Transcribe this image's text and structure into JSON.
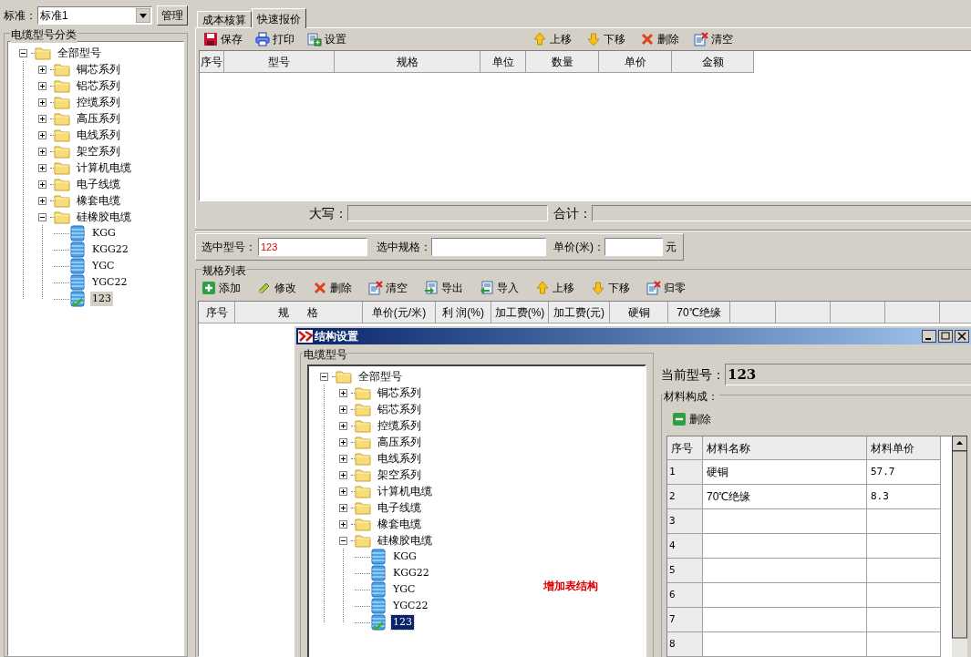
{
  "standard": {
    "label": "标准：",
    "value": "标准1",
    "manage_button": "管理"
  },
  "category_panel": {
    "title": "电缆型号分类",
    "tree": [
      {
        "label": "全部型号",
        "kind": "folder",
        "expanded": true,
        "selected": false,
        "children": [
          {
            "label": "铜芯系列",
            "kind": "folder",
            "expanded": false,
            "selected": false
          },
          {
            "label": "铝芯系列",
            "kind": "folder",
            "expanded": false,
            "selected": false
          },
          {
            "label": "控缆系列",
            "kind": "folder",
            "expanded": false,
            "selected": false
          },
          {
            "label": "高压系列",
            "kind": "folder",
            "expanded": false,
            "selected": false
          },
          {
            "label": "电线系列",
            "kind": "folder",
            "expanded": false,
            "selected": false
          },
          {
            "label": "架空系列",
            "kind": "folder",
            "expanded": false,
            "selected": false
          },
          {
            "label": "计算机电缆",
            "kind": "folder",
            "expanded": false,
            "selected": false
          },
          {
            "label": "电子线缆",
            "kind": "folder",
            "expanded": false,
            "selected": false
          },
          {
            "label": "橡套电缆",
            "kind": "folder",
            "expanded": false,
            "selected": false
          },
          {
            "label": "硅橡胶电缆",
            "kind": "folder",
            "expanded": true,
            "selected": false,
            "children": [
              {
                "label": "KGG",
                "kind": "model",
                "checked": false,
                "selected": false
              },
              {
                "label": "KGG22",
                "kind": "model",
                "checked": false,
                "selected": false
              },
              {
                "label": "YGC",
                "kind": "model",
                "checked": false,
                "selected": false
              },
              {
                "label": "YGC22",
                "kind": "model",
                "checked": false,
                "selected": false
              },
              {
                "label": "123",
                "kind": "model",
                "checked": true,
                "selected": true
              }
            ]
          }
        ]
      }
    ]
  },
  "tabs": [
    {
      "label": "成本核算",
      "selected": false
    },
    {
      "label": "快速报价",
      "selected": true
    }
  ],
  "quote": {
    "toolbar_left": [
      {
        "kind": "save",
        "label": "保存"
      },
      {
        "kind": "print",
        "label": "打印"
      },
      {
        "kind": "settings",
        "label": "设置"
      }
    ],
    "toolbar_right": [
      {
        "kind": "up",
        "label": "上移"
      },
      {
        "kind": "down",
        "label": "下移"
      },
      {
        "kind": "delete",
        "label": "删除"
      },
      {
        "kind": "clear",
        "label": "清空"
      }
    ],
    "columns": [
      "序号",
      "型号",
      "规格",
      "单位",
      "数量",
      "单价",
      "金额"
    ],
    "uppercase_label": "大写：",
    "total_label": "合计："
  },
  "selection": {
    "model_label": "选中型号：",
    "model_value": "123",
    "spec_label": "选中规格：",
    "price_label": "单价(米)：",
    "price_unit": "元"
  },
  "spec_list": {
    "title": "规格列表",
    "toolbar": [
      {
        "kind": "add",
        "label": "添加"
      },
      {
        "kind": "edit",
        "label": "修改"
      },
      {
        "kind": "delete",
        "label": "删除"
      },
      {
        "kind": "clear",
        "label": "清空"
      },
      {
        "kind": "export",
        "label": "导出"
      },
      {
        "kind": "import",
        "label": "导入"
      },
      {
        "kind": "up",
        "label": "上移"
      },
      {
        "kind": "down",
        "label": "下移"
      },
      {
        "kind": "clear",
        "label": "归零"
      }
    ],
    "columns": [
      "序号",
      "规      格",
      "单价(元/米)",
      "利 润(%)",
      "加工费(%)",
      "加工费(元)",
      "硬铜",
      "70℃绝缘"
    ]
  },
  "dialog": {
    "title": "结构设置",
    "tree_group": "电缆型号",
    "tree": [
      {
        "label": "全部型号",
        "kind": "folder",
        "expanded": true,
        "selected": false,
        "children": [
          {
            "label": "铜芯系列",
            "kind": "folder",
            "expanded": false,
            "selected": false
          },
          {
            "label": "铝芯系列",
            "kind": "folder",
            "expanded": false,
            "selected": false
          },
          {
            "label": "控缆系列",
            "kind": "folder",
            "expanded": false,
            "selected": false
          },
          {
            "label": "高压系列",
            "kind": "folder",
            "expanded": false,
            "selected": false
          },
          {
            "label": "电线系列",
            "kind": "folder",
            "expanded": false,
            "selected": false
          },
          {
            "label": "架空系列",
            "kind": "folder",
            "expanded": false,
            "selected": false
          },
          {
            "label": "计算机电缆",
            "kind": "folder",
            "expanded": false,
            "selected": false
          },
          {
            "label": "电子线缆",
            "kind": "folder",
            "expanded": false,
            "selected": false
          },
          {
            "label": "橡套电缆",
            "kind": "folder",
            "expanded": false,
            "selected": false
          },
          {
            "label": "硅橡胶电缆",
            "kind": "folder",
            "expanded": true,
            "selected": false,
            "children": [
              {
                "label": "KGG",
                "kind": "model",
                "checked": false,
                "selected": false
              },
              {
                "label": "KGG22",
                "kind": "model",
                "checked": false,
                "selected": false
              },
              {
                "label": "YGC",
                "kind": "model",
                "checked": false,
                "selected": false
              },
              {
                "label": "YGC22",
                "kind": "model",
                "checked": false,
                "selected": false
              },
              {
                "label": "123",
                "kind": "model",
                "checked": true,
                "selected": true
              }
            ]
          }
        ]
      }
    ],
    "annotation": "增加表结构",
    "current_model_label": "当前型号：",
    "current_model_value": "123",
    "materials_group": "材料构成：",
    "delete_button": "删除",
    "columns": [
      "序号",
      "材料名称",
      "材料单价"
    ],
    "rows": [
      {
        "index": "1",
        "name": "硬铜",
        "price": "57.7"
      },
      {
        "index": "2",
        "name": "70℃绝缘",
        "price": "8.3"
      },
      {
        "index": "3"
      },
      {
        "index": "4"
      },
      {
        "index": "5"
      },
      {
        "index": "6"
      },
      {
        "index": "7"
      },
      {
        "index": "8"
      }
    ]
  }
}
